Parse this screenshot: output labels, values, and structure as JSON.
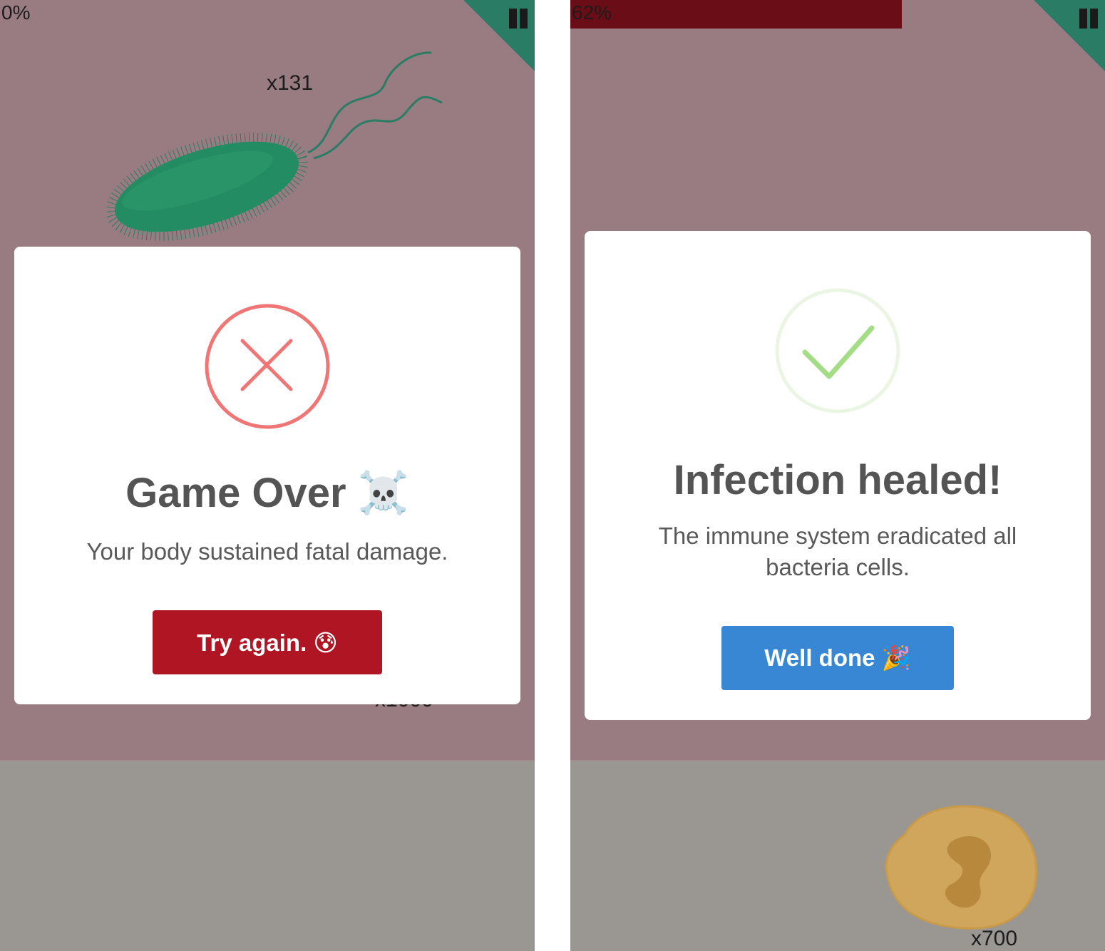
{
  "game_over_screen": {
    "progress_label": "0%",
    "progress": 0,
    "bacteria_count": "x131",
    "hidden_counter": "x1000",
    "modal": {
      "title": "Game Over ☠️",
      "message": "Your body sustained fatal damage.",
      "button_label": "Try again. 😰",
      "icon": "error-x-icon",
      "accent_color": "#f07575",
      "button_color": "#af1522"
    }
  },
  "success_screen": {
    "progress_label": "62%",
    "progress": 0.62,
    "cell_count": "x700",
    "modal": {
      "title": "Infection healed!",
      "message": "The immune system eradicated all bacteria cells.",
      "button_label": "Well done 🎉",
      "icon": "success-check-icon",
      "accent_color": "#a5dc86",
      "button_color": "#3787d5"
    }
  },
  "colors": {
    "field": "#997b82",
    "tissue": "#9a9793",
    "corner": "#2a7c65",
    "progress_fill": "#6a0d16"
  }
}
